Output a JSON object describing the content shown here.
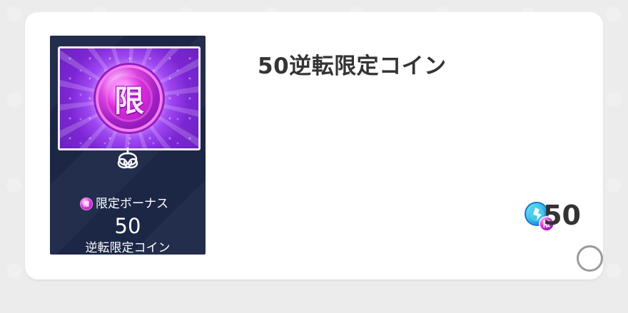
{
  "item": {
    "title": "50逆転限定コイン",
    "thumbnail": {
      "coin_symbol": "限",
      "bonus_label": "限定ボーナス",
      "count": "50",
      "name": "逆転限定コイン"
    },
    "reward": {
      "amount": "50",
      "icon_name": "limited-coin-icon"
    },
    "selected": false
  },
  "colors": {
    "background": "#ececec",
    "card": "#ffffff",
    "title_text": "#343434",
    "thumbnail_bg": "#1c2746",
    "coin_purple": "#b324d1",
    "selection_ring": "#9a9a9a"
  }
}
